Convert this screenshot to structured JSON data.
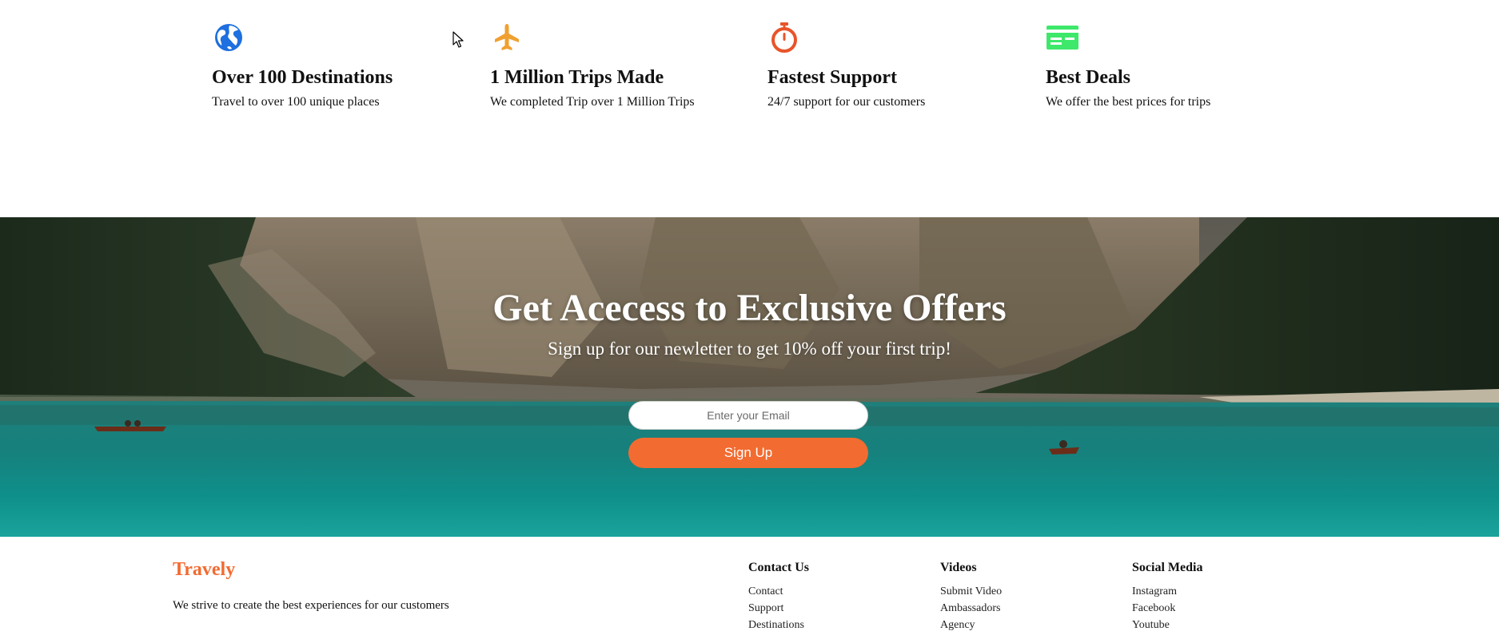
{
  "features": [
    {
      "icon": "globe-icon",
      "color": "#1e6fe0",
      "title": "Over 100 Destinations",
      "description": "Travel to over 100 unique places"
    },
    {
      "icon": "airplane-icon",
      "color": "#f0a030",
      "title": "1 Million Trips Made",
      "description": "We completed Trip over 1 Million Trips"
    },
    {
      "icon": "stopwatch-icon",
      "color": "#e8542a",
      "title": "Fastest Support",
      "description": "24/7 support for our customers"
    },
    {
      "icon": "credit-card-icon",
      "color": "#3ee86b",
      "title": "Best Deals",
      "description": "We offer the best prices for trips"
    }
  ],
  "newsletter": {
    "title": "Get Acecess to Exclusive Offers",
    "subtitle": "Sign up for our newletter to get 10% off your first trip!",
    "email_placeholder": "Enter your Email",
    "button_label": "Sign Up",
    "button_color": "#f26b31"
  },
  "footer": {
    "brand": "Travely",
    "brand_color": "#f26b31",
    "tagline": "We strive to create the best experiences for our customers",
    "columns": [
      {
        "heading": "Contact Us",
        "links": [
          "Contact",
          "Support",
          "Destinations"
        ]
      },
      {
        "heading": "Videos",
        "links": [
          "Submit Video",
          "Ambassadors",
          "Agency"
        ]
      },
      {
        "heading": "Social Media",
        "links": [
          "Instagram",
          "Facebook",
          "Youtube"
        ]
      }
    ]
  }
}
